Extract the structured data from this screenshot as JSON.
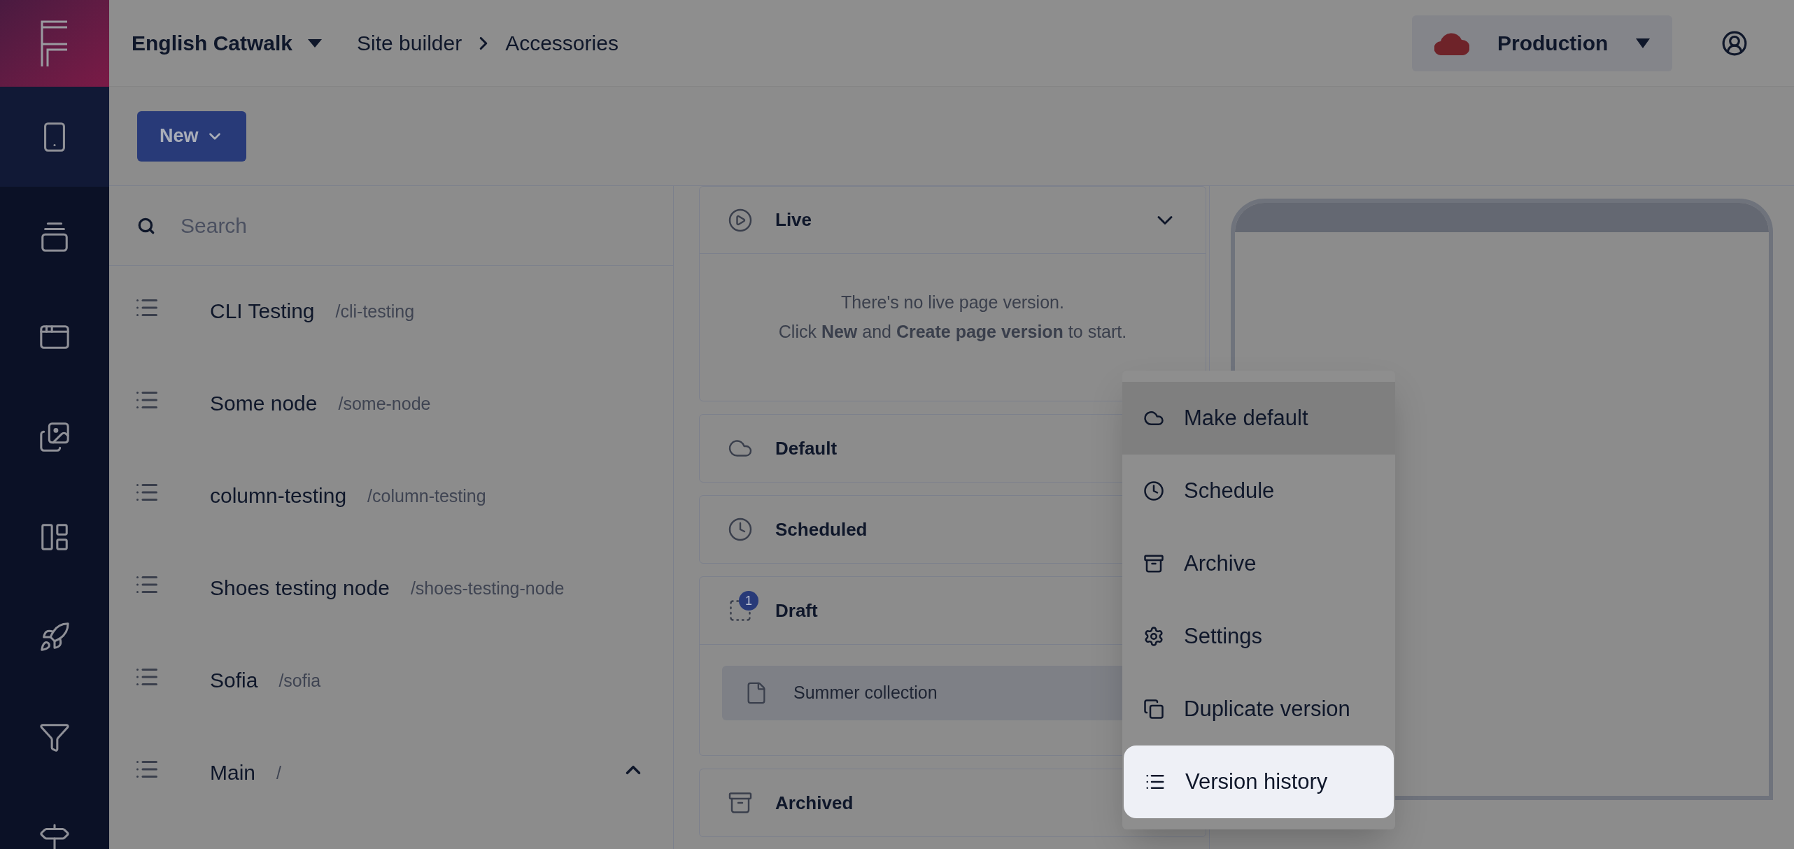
{
  "topbar": {
    "workspace": "English Catwalk",
    "breadcrumbs": [
      "Site builder",
      "Accessories"
    ],
    "environment": "Production"
  },
  "sidebar": {
    "items": [
      {
        "selected": true
      },
      {
        "selected": false
      },
      {
        "selected": false
      },
      {
        "selected": false
      },
      {
        "selected": false
      },
      {
        "selected": false
      },
      {
        "selected": false
      },
      {
        "selected": false
      }
    ]
  },
  "toolbar": {
    "new_button": "New"
  },
  "search": {
    "placeholder": "Search"
  },
  "nodes": [
    {
      "name": "CLI Testing",
      "path": "/cli-testing",
      "expanded": false
    },
    {
      "name": "Some node",
      "path": "/some-node",
      "expanded": false
    },
    {
      "name": "column-testing",
      "path": "/column-testing",
      "expanded": false
    },
    {
      "name": "Shoes testing node",
      "path": "/shoes-testing-node",
      "expanded": false
    },
    {
      "name": "Sofia",
      "path": "/sofia",
      "expanded": false
    },
    {
      "name": "Main",
      "path": "/",
      "expanded": true
    }
  ],
  "sections": [
    {
      "kind": "live",
      "title": "Live",
      "expanded": true,
      "message": [
        "There's no live page version.",
        "Click **New** and **Create page version** to start."
      ]
    },
    {
      "kind": "default",
      "title": "Default"
    },
    {
      "kind": "scheduled",
      "title": "Scheduled"
    },
    {
      "kind": "draft",
      "title": "Draft",
      "badge": "1",
      "expanded": true,
      "versions": [
        "Summer collection"
      ]
    },
    {
      "kind": "archived",
      "title": "Archived"
    }
  ],
  "menu": [
    {
      "kind": "default",
      "label": "Make default",
      "hovered": true,
      "selected": false
    },
    {
      "kind": "schedule",
      "label": "Schedule",
      "hovered": false,
      "selected": false
    },
    {
      "kind": "archive",
      "label": "Archive",
      "hovered": false,
      "selected": false
    },
    {
      "kind": "settings",
      "label": "Settings",
      "hovered": false,
      "selected": false
    },
    {
      "kind": "duplicate",
      "label": "Duplicate version",
      "hovered": false,
      "selected": false
    },
    {
      "kind": "history",
      "label": "Version history",
      "hovered": false,
      "selected": true
    }
  ]
}
